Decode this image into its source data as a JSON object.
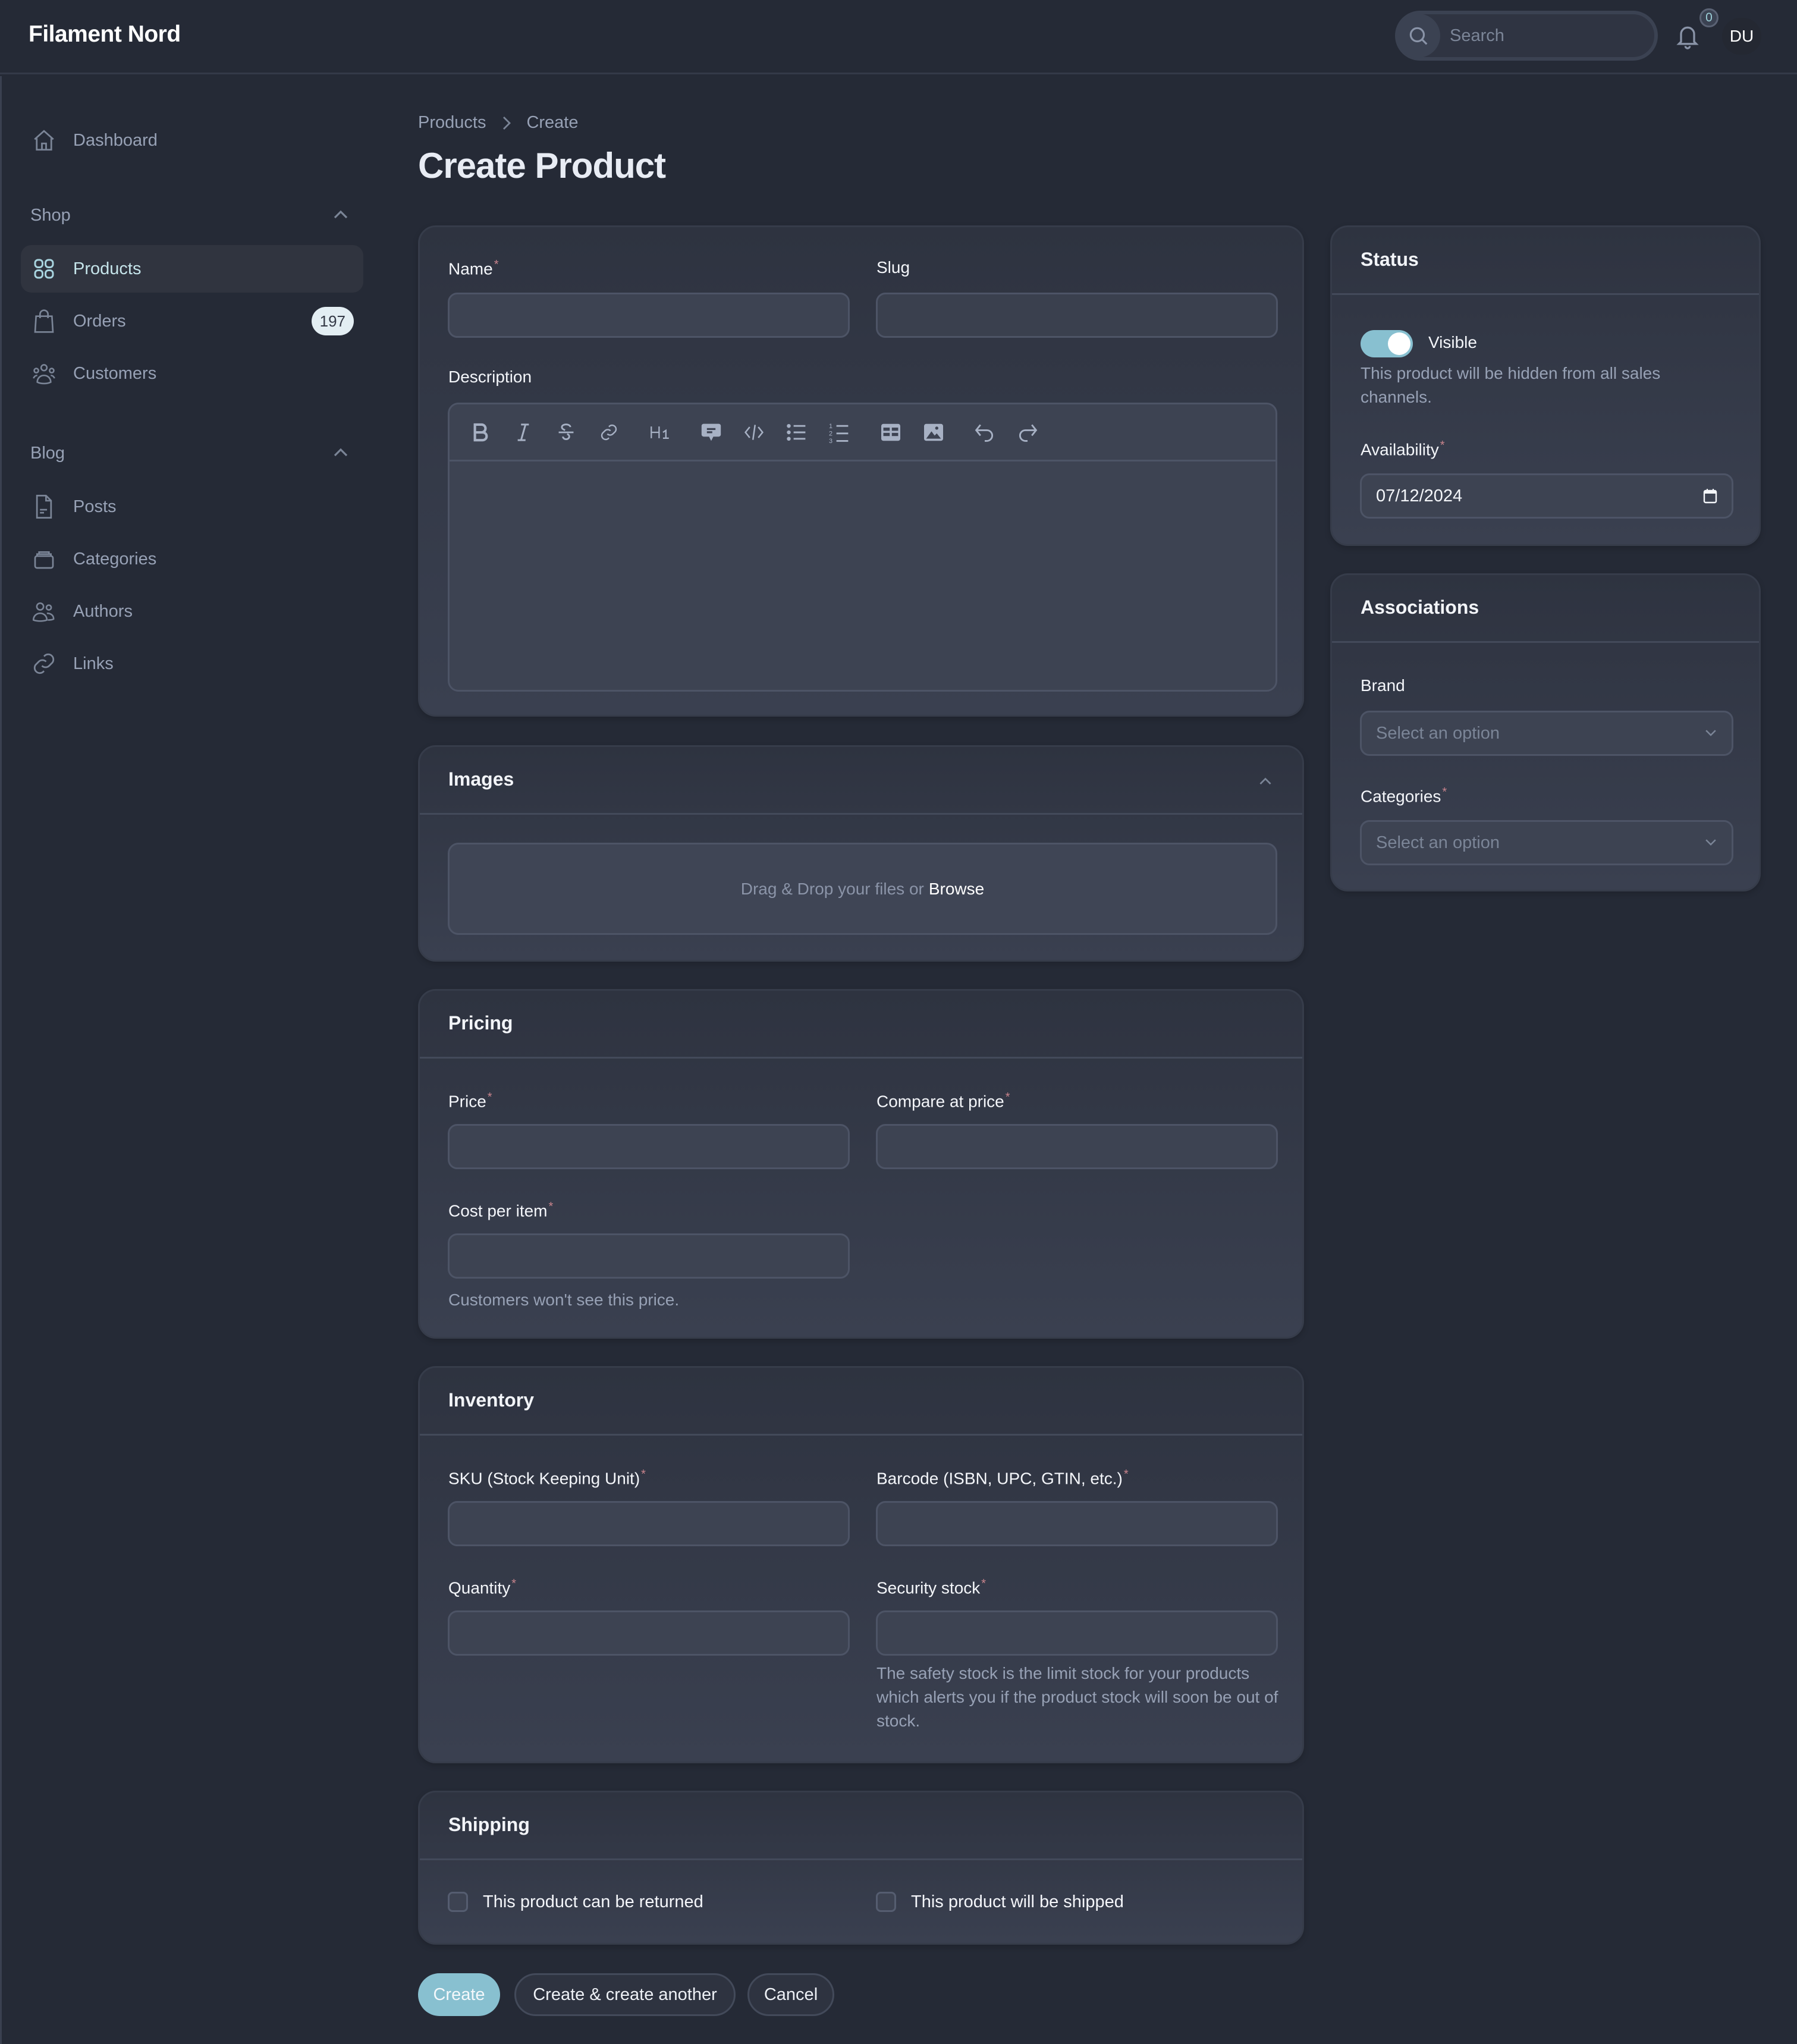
{
  "app": {
    "title": "Filament Nord",
    "search_placeholder": "Search",
    "notifications_count": "0",
    "user_initials": "DU"
  },
  "sidebar": {
    "dashboard": {
      "label": "Dashboard",
      "icon": "home-icon"
    },
    "groups": [
      {
        "label": "Shop",
        "collapsed": false,
        "items": [
          {
            "label": "Products",
            "icon": "squares-icon",
            "active": true
          },
          {
            "label": "Orders",
            "icon": "shopping-bag-icon",
            "badge": "197"
          },
          {
            "label": "Customers",
            "icon": "user-group-icon"
          }
        ]
      },
      {
        "label": "Blog",
        "collapsed": false,
        "items": [
          {
            "label": "Posts",
            "icon": "document-text-icon"
          },
          {
            "label": "Categories",
            "icon": "rectangle-stack-icon"
          },
          {
            "label": "Authors",
            "icon": "users-icon"
          },
          {
            "label": "Links",
            "icon": "link-icon"
          }
        ]
      }
    ]
  },
  "breadcrumb": [
    "Products",
    "Create"
  ],
  "page_title": "Create Product",
  "form": {
    "general": {
      "name_label": "Name",
      "name_value": "",
      "slug_label": "Slug",
      "slug_value": "",
      "description_label": "Description",
      "description_value": "",
      "toolbar": [
        "bold",
        "italic",
        "strike",
        "link",
        "heading-1",
        "blockquote",
        "code-block",
        "bullet-list",
        "ordered-list",
        "table",
        "image",
        "undo",
        "redo"
      ]
    },
    "images": {
      "title": "Images",
      "dropzone_text": "Drag & Drop your files or",
      "browse_label": "Browse"
    },
    "pricing": {
      "title": "Pricing",
      "price_label": "Price",
      "compare_label": "Compare at price",
      "cost_label": "Cost per item",
      "cost_hint": "Customers won't see this price."
    },
    "inventory": {
      "title": "Inventory",
      "sku_label": "SKU (Stock Keeping Unit)",
      "barcode_label": "Barcode (ISBN, UPC, GTIN, etc.)",
      "quantity_label": "Quantity",
      "security_label": "Security stock",
      "security_hint": "The safety stock is the limit stock for your products which alerts you if the product stock will soon be out of stock."
    },
    "shipping": {
      "title": "Shipping",
      "returnable_label": "This product can be returned",
      "returnable_checked": false,
      "shipped_label": "This product will be shipped",
      "shipped_checked": false
    },
    "status": {
      "title": "Status",
      "visible_label": "Visible",
      "visible_on": true,
      "visible_hint": "This product will be hidden from all sales channels.",
      "availability_label": "Availability",
      "availability_value": "07/12/2024"
    },
    "associations": {
      "title": "Associations",
      "brand_label": "Brand",
      "brand_placeholder": "Select an option",
      "categories_label": "Categories",
      "categories_placeholder": "Select an option"
    },
    "actions": {
      "create": "Create",
      "create_another": "Create & create another",
      "cancel": "Cancel"
    }
  },
  "colors": {
    "background": "#252a36",
    "accent": "#88c0d0",
    "panel": "#343a48",
    "required": "#c9848c"
  }
}
